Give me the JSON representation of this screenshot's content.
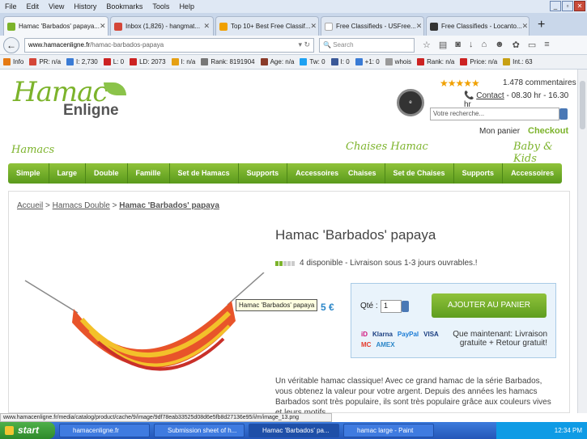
{
  "menu": [
    "File",
    "Edit",
    "View",
    "History",
    "Bookmarks",
    "Tools",
    "Help"
  ],
  "tabs": [
    {
      "label": "Hamac 'Barbados' papaya...",
      "color": "#7cb32b",
      "active": true
    },
    {
      "label": "Inbox (1,826) - hangmat...",
      "color": "#d44638",
      "active": false
    },
    {
      "label": "Top 10+ Best Free Classif...",
      "color": "#f0a000",
      "active": false
    },
    {
      "label": "Free Classifieds - USFree...",
      "color": "#fff",
      "active": false
    },
    {
      "label": "Free Classifieds - Locanto...",
      "color": "#333",
      "active": false
    }
  ],
  "url": {
    "host": "www.hamacenligne.fr",
    "path": "/hamac-barbados-papaya"
  },
  "search_placeholder": "Search",
  "addons": [
    "Info",
    "PR: n/a",
    "I: 2,730",
    "L: 0",
    "LD: 2073",
    "I: n/a",
    "Rank: 8191904",
    "Age: n/a",
    "Tw: 0",
    "I: 0",
    "+1: 0",
    "whois",
    "Rank: n/a",
    "Price: n/a",
    "Int.: 63"
  ],
  "header": {
    "logo_top": "Hamac",
    "logo_bottom": "Enligne",
    "comments": "1.478 commentaires",
    "contact_label": "Contact",
    "contact_hours": " - 08.30 hr - 16.30 hr",
    "search_placeholder": "Votre recherche...",
    "cart": "Mon panier",
    "checkout": "Checkout"
  },
  "sections": {
    "hamacs": "Hamacs",
    "chaises": "Chaises Hamac",
    "baby": "Baby & Kids"
  },
  "nav_hamacs": [
    "Simple",
    "Large",
    "Double",
    "Famille",
    "Set de Hamacs",
    "Supports",
    "Accessoires"
  ],
  "nav_chaises": [
    "Chaises",
    "Set de Chaises",
    "Supports",
    "Accessoires"
  ],
  "breadcrumb": {
    "home": "Accueil",
    "cat": "Hamacs Double",
    "current": "Hamac 'Barbados' papaya"
  },
  "product": {
    "title": "Hamac 'Barbados' papaya",
    "stock": "4 disponible - Livraison sous 1-3 jours ouvrables.!",
    "stock_level": 0.4,
    "price_fragment": "5 €",
    "tooltip": "Hamac 'Barbados' papaya",
    "qty_label": "Qté :",
    "qty": "1",
    "add_button": "AJOUTER AU PANIER",
    "pay_info": "Que maintenant: Livraison gratuite + Retour gratuit!",
    "description": "Un véritable hamac classique! Avec ce grand hamac de la série Barbados, vous obtenez la valeur pour votre argent. Depuis des années les hamacs Barbados sont très populaire, ils sont très populaire grâce aux couleurs vives et leurs motifs..."
  },
  "status_url": "www.hamacenligne.fr/media/catalog/product/cache/9/image/9df78eab33525d08d6e5fb8d27136e95/i/m/image_13.png",
  "taskbar": {
    "start": "start",
    "tasks": [
      "hamacenligne.fr",
      "Submission sheet of h...",
      "Hamac 'Barbados' pa...",
      "hamac large - Paint"
    ],
    "clock": "12:34 PM"
  }
}
